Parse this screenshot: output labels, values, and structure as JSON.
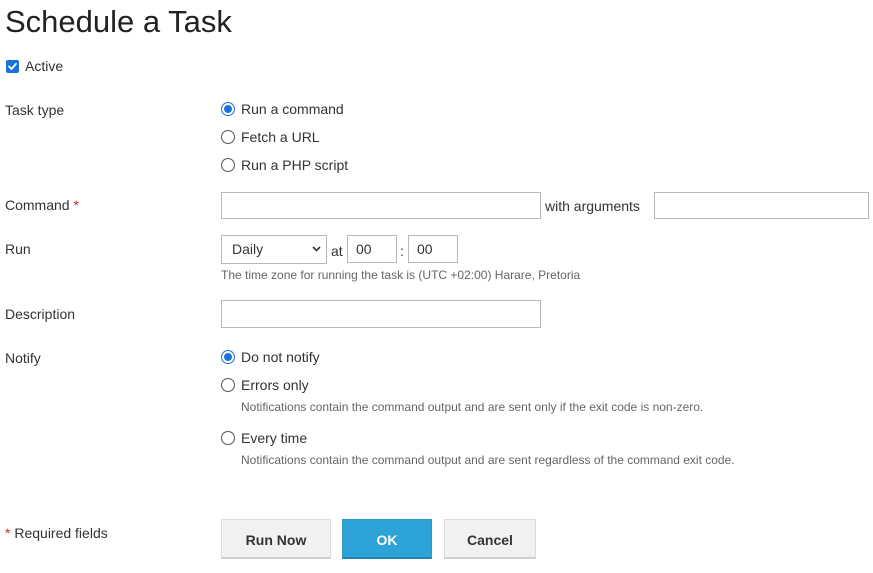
{
  "page": {
    "title": "Schedule a Task"
  },
  "active": {
    "label": "Active",
    "checked": true
  },
  "task_type": {
    "label": "Task type",
    "options": [
      {
        "label": "Run a command",
        "selected": true
      },
      {
        "label": "Fetch a URL",
        "selected": false
      },
      {
        "label": "Run a PHP script",
        "selected": false
      }
    ]
  },
  "command": {
    "label": "Command",
    "required_mark": "*",
    "value": "",
    "arguments_label": "with arguments",
    "arguments_value": ""
  },
  "run": {
    "label": "Run",
    "frequency": "Daily",
    "at_label": "at",
    "hour": "00",
    "separator": ":",
    "minute": "00",
    "timezone_hint": "The time zone for running the task is (UTC +02:00) Harare, Pretoria"
  },
  "description": {
    "label": "Description",
    "value": ""
  },
  "notify": {
    "label": "Notify",
    "options": [
      {
        "label": "Do not notify",
        "selected": true,
        "hint": ""
      },
      {
        "label": "Errors only",
        "selected": false,
        "hint": "Notifications contain the command output and are sent only if the exit code is non-zero."
      },
      {
        "label": "Every time",
        "selected": false,
        "hint": "Notifications contain the command output and are sent regardless of the command exit code."
      }
    ]
  },
  "footer": {
    "required_mark": "*",
    "required_text": "Required fields",
    "run_now_label": "Run Now",
    "ok_label": "OK",
    "cancel_label": "Cancel"
  },
  "colors": {
    "accent": "#1a73d9",
    "primary_button": "#2ea3d8",
    "required": "#d02c2c"
  }
}
